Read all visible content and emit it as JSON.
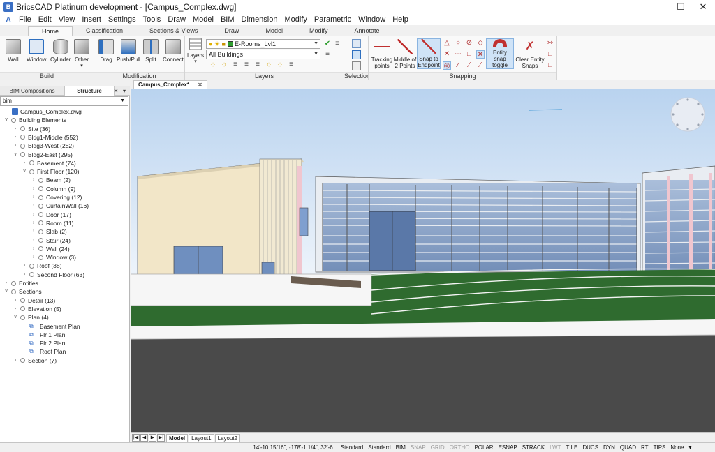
{
  "window": {
    "title": "BricsCAD Platinum development - [Campus_Complex.dwg]",
    "app_icon": "bricscad-logo-icon"
  },
  "menu": [
    "File",
    "Edit",
    "View",
    "Insert",
    "Settings",
    "Tools",
    "Draw",
    "Model",
    "BIM",
    "Dimension",
    "Modify",
    "Parametric",
    "Window",
    "Help"
  ],
  "ribbon_tabs": [
    "Home",
    "Classification",
    "Sections & Views",
    "Draw",
    "Model",
    "Modify",
    "Annotate"
  ],
  "ribbon": {
    "build": {
      "title": "Build",
      "buttons": [
        "Wall",
        "Window",
        "Cylinder",
        "Other"
      ]
    },
    "modification": {
      "title": "Modification",
      "buttons": [
        "Drag",
        "Push/Pull",
        "Split",
        "Connect"
      ]
    },
    "layers": {
      "title": "Layers",
      "button": "Layers",
      "current_layer": "E-Rooms_Lvl1",
      "filter": "All Buildings"
    },
    "selection": {
      "title": "Selection"
    },
    "snapping": {
      "title": "Snapping",
      "tracking": "Tracking\npoints",
      "tracking_l1": "Tracking",
      "tracking_l2": "points",
      "middle_l1": "Middle of",
      "middle_l2": "2 Points",
      "snap_end_l1": "Snap to",
      "snap_end_l2": "Endpoint",
      "entity_l1": "Entity snap",
      "entity_l2": "toggle",
      "clear_l1": "Clear Entity",
      "clear_l2": "Snaps"
    }
  },
  "left_panel": {
    "tabs": [
      "BIM Compositions",
      "Structure"
    ],
    "filter_value": "bim",
    "tree": [
      {
        "label": "Campus_Complex.dwg",
        "level": 0,
        "kind": "file"
      },
      {
        "label": "Building Elements",
        "level": 0,
        "kind": "node",
        "open": true
      },
      {
        "label": "Site (36)",
        "level": 1,
        "kind": "node"
      },
      {
        "label": "Bldg1-Middle (552)",
        "level": 1,
        "kind": "node"
      },
      {
        "label": "Bldg3-West (282)",
        "level": 1,
        "kind": "node"
      },
      {
        "label": "Bldg2-East (295)",
        "level": 1,
        "kind": "node",
        "open": true
      },
      {
        "label": "Basement (74)",
        "level": 2,
        "kind": "node"
      },
      {
        "label": "First Floor (120)",
        "level": 2,
        "kind": "node",
        "open": true
      },
      {
        "label": "Beam (2)",
        "level": 3,
        "kind": "node"
      },
      {
        "label": "Column (9)",
        "level": 3,
        "kind": "node"
      },
      {
        "label": "Covering (12)",
        "level": 3,
        "kind": "node"
      },
      {
        "label": "CurtainWall (16)",
        "level": 3,
        "kind": "node"
      },
      {
        "label": "Door (17)",
        "level": 3,
        "kind": "node"
      },
      {
        "label": "Room (11)",
        "level": 3,
        "kind": "node"
      },
      {
        "label": "Slab (2)",
        "level": 3,
        "kind": "node"
      },
      {
        "label": "Stair (24)",
        "level": 3,
        "kind": "node"
      },
      {
        "label": "Wall (24)",
        "level": 3,
        "kind": "node"
      },
      {
        "label": "Window (3)",
        "level": 3,
        "kind": "node"
      },
      {
        "label": "Roof (38)",
        "level": 2,
        "kind": "node"
      },
      {
        "label": "Second Floor (63)",
        "level": 2,
        "kind": "node"
      },
      {
        "label": "Entities",
        "level": 0,
        "kind": "node"
      },
      {
        "label": "Sections",
        "level": 0,
        "kind": "node",
        "open": true
      },
      {
        "label": "Detail (13)",
        "level": 1,
        "kind": "node"
      },
      {
        "label": "Elevation (5)",
        "level": 1,
        "kind": "node"
      },
      {
        "label": "Plan (4)",
        "level": 1,
        "kind": "node",
        "open": true
      },
      {
        "label": "Basement Plan",
        "level": 2,
        "kind": "section"
      },
      {
        "label": "Flr 1 Plan",
        "level": 2,
        "kind": "section"
      },
      {
        "label": "Flr 2 Plan",
        "level": 2,
        "kind": "section"
      },
      {
        "label": "Roof Plan",
        "level": 2,
        "kind": "section"
      },
      {
        "label": "Section (7)",
        "level": 1,
        "kind": "node"
      }
    ]
  },
  "document_tab": "Campus_Complex*",
  "layout_tabs": [
    "Model",
    "Layout1",
    "Layout2"
  ],
  "status": {
    "coords": "14'-10 15/16\", -178'-1 1/4\", 32'-6",
    "items": [
      {
        "label": "Standard",
        "on": true
      },
      {
        "label": "Standard",
        "on": true
      },
      {
        "label": "BIM",
        "on": true
      },
      {
        "label": "SNAP",
        "on": false
      },
      {
        "label": "GRID",
        "on": false
      },
      {
        "label": "ORTHO",
        "on": false
      },
      {
        "label": "POLAR",
        "on": true
      },
      {
        "label": "ESNAP",
        "on": true
      },
      {
        "label": "STRACK",
        "on": true
      },
      {
        "label": "LWT",
        "on": false
      },
      {
        "label": "TILE",
        "on": true
      },
      {
        "label": "DUCS",
        "on": true
      },
      {
        "label": "DYN",
        "on": true
      },
      {
        "label": "QUAD",
        "on": true
      },
      {
        "label": "RT",
        "on": true
      },
      {
        "label": "TIPS",
        "on": true
      },
      {
        "label": "None",
        "on": true
      }
    ]
  },
  "colors": {
    "sky_top": "#c9dff4",
    "grass": "#2f6b2f",
    "road": "#4a4a4a",
    "accent": "#3a6fc4"
  }
}
